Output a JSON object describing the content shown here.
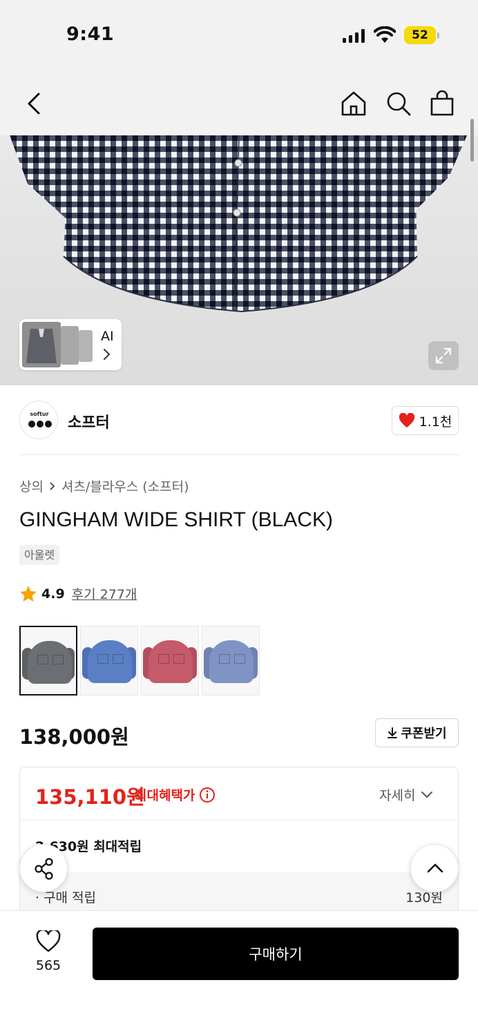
{
  "status_bar": {
    "time": "9:41",
    "battery": "52"
  },
  "gallery": {
    "ai_label": "AI"
  },
  "brand": {
    "logo_text": "softur",
    "name": "소프터",
    "likes": "1.1천"
  },
  "product": {
    "breadcrumb": [
      "상의",
      "셔츠/블라우스 (소프터)"
    ],
    "title": "GINGHAM WIDE SHIRT (BLACK)",
    "badge": "아울렛",
    "rating": "4.9",
    "reviews": "후기 277개",
    "color_options": [
      {
        "name": "black",
        "color": "#6b6f73",
        "selected": true
      },
      {
        "name": "blue",
        "color": "#5b7fc4",
        "selected": false
      },
      {
        "name": "red",
        "color": "#c45a6a",
        "selected": false
      },
      {
        "name": "navy",
        "color": "#7f93c4",
        "selected": false
      }
    ],
    "price": "138,000원",
    "coupon_label": "쿠폰받기"
  },
  "benefit": {
    "sale_price": "135,110원",
    "sale_label": "최대혜택가",
    "detail_label": "자세히",
    "points": "2,630원 최대적립",
    "purchase_points_label": "· 구매 적립",
    "purchase_points_value": "130원"
  },
  "bottom": {
    "wish_count": "565",
    "buy_label": "구매하기"
  },
  "colors": {
    "sale_red": "#e2231a",
    "heart_red": "#e2231a",
    "battery_yellow": "#f5d90a"
  }
}
